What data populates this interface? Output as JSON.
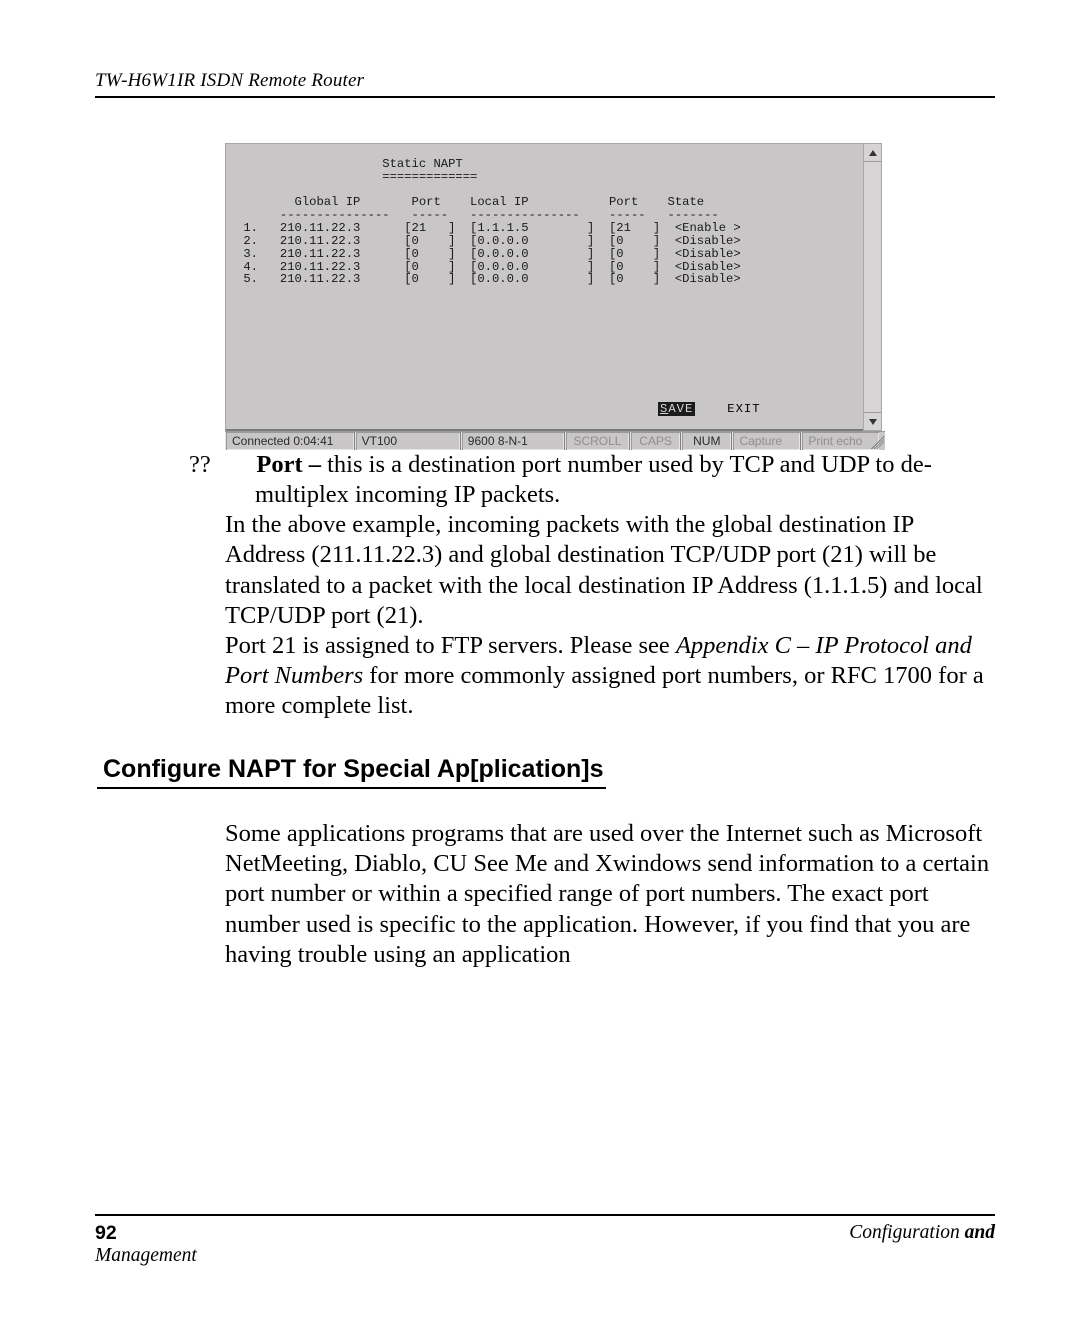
{
  "header": {
    "running": "TW-H6W1IR ISDN Remote Router"
  },
  "terminal": {
    "title": "Static NAPT",
    "rule": "=============",
    "cols": {
      "global_ip": "Global IP",
      "port1": "Port",
      "local_ip": "Local IP",
      "port2": "Port",
      "state": "State"
    },
    "dash": {
      "global_ip": "---------------",
      "port1": "-----",
      "local_ip": "---------------",
      "port2": "-----",
      "state": "-------"
    },
    "rows": [
      {
        "n": "1.",
        "gip": "210.11.22.3",
        "p1": "21",
        "lip": "1.1.1.5",
        "p2": "21",
        "state": "<Enable >"
      },
      {
        "n": "2.",
        "gip": "210.11.22.3",
        "p1": "0",
        "lip": "0.0.0.0",
        "p2": "0",
        "state": "<Disable>"
      },
      {
        "n": "3.",
        "gip": "210.11.22.3",
        "p1": "0",
        "lip": "0.0.0.0",
        "p2": "0",
        "state": "<Disable>"
      },
      {
        "n": "4.",
        "gip": "210.11.22.3",
        "p1": "0",
        "lip": "0.0.0.0",
        "p2": "0",
        "state": "<Disable>"
      },
      {
        "n": "5.",
        "gip": "210.11.22.3",
        "p1": "0",
        "lip": "0.0.0.0",
        "p2": "0",
        "state": "<Disable>"
      }
    ],
    "buttons": {
      "save": "SAVE",
      "exit": "EXIT"
    },
    "status": {
      "connected": "Connected 0:04:41",
      "emu": "VT100",
      "serial": "9600 8-N-1",
      "scroll": "SCROLL",
      "caps": "CAPS",
      "num": "NUM",
      "capture": "Capture",
      "echo": "Print echo"
    }
  },
  "text": {
    "bullet_marker": "??",
    "bullet_label": "Port –",
    "bullet_body": " this is a destination port number used by TCP and UDP to de-multiplex incoming IP packets.",
    "para_example": "In the above example, incoming packets with the global destination IP Address (211.11.22.3) and global destination TCP/UDP port (21) will be translated to a packet with the local destination IP Address (1.1.1.5) and local TCP/UDP port (21).",
    "para_ftp_a": "Port 21 is assigned to FTP servers. Please see ",
    "para_ftp_i": "Appendix C – IP Protocol and Port Numbers",
    "para_ftp_b": " for more commonly assigned port numbers, or RFC 1700 for a more complete list.",
    "heading": " Configure NAPT for Special Ap[plication]s",
    "para_apps": "Some applications programs that are used over the Internet such as Microsoft NetMeeting, Diablo, CU See Me and Xwindows send information to a certain port number or within a specified range of port numbers. The exact port number used is specific to the application. However, if you find that you are having trouble using an application"
  },
  "footer": {
    "page": "92",
    "right_a": "Configuration ",
    "right_b": "and",
    "left_b": "Management"
  }
}
